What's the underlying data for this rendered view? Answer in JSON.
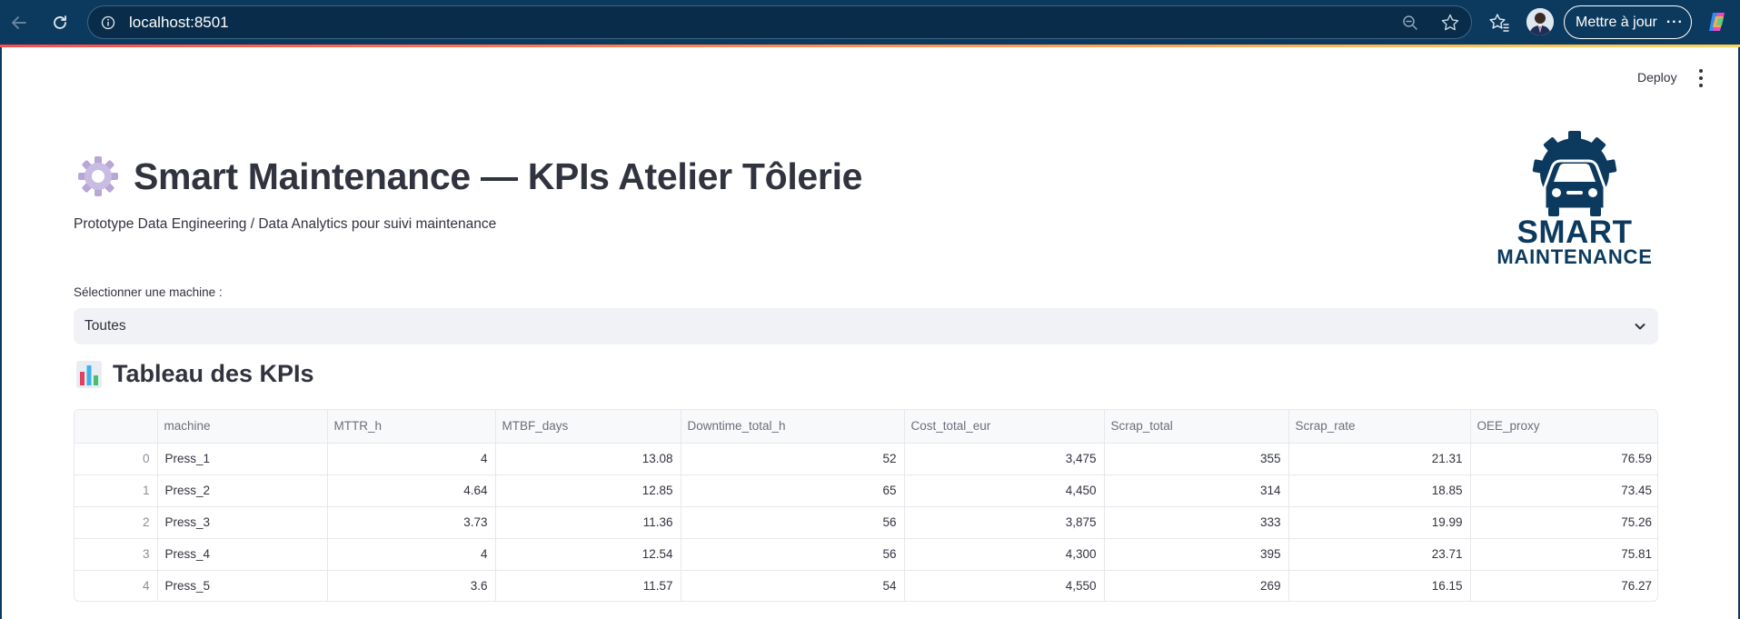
{
  "browser": {
    "url": "localhost:8501",
    "update_label": "Mettre à jour",
    "more_dots": "···"
  },
  "app": {
    "deploy_label": "Deploy",
    "title": "Smart Maintenance — KPIs Atelier Tôlerie",
    "subtitle": "Prototype Data Engineering / Data Analytics pour suivi maintenance",
    "logo_line1": "SMART",
    "logo_line2": "MAINTENANCE",
    "select": {
      "label": "Sélectionner une machine :",
      "value": "Toutes"
    },
    "section_title": "Tableau des KPIs"
  },
  "table": {
    "columns": [
      "",
      "machine",
      "MTTR_h",
      "MTBF_days",
      "Downtime_total_h",
      "Cost_total_eur",
      "Scrap_total",
      "Scrap_rate",
      "OEE_proxy"
    ],
    "rows": [
      [
        "0",
        "Press_1",
        "4",
        "13.08",
        "52",
        "3,475",
        "355",
        "21.31",
        "76.59"
      ],
      [
        "1",
        "Press_2",
        "4.64",
        "12.85",
        "65",
        "4,450",
        "314",
        "18.85",
        "73.45"
      ],
      [
        "2",
        "Press_3",
        "3.73",
        "11.36",
        "56",
        "3,875",
        "333",
        "19.99",
        "75.26"
      ],
      [
        "3",
        "Press_4",
        "4",
        "12.54",
        "56",
        "4,300",
        "395",
        "23.71",
        "75.81"
      ],
      [
        "4",
        "Press_5",
        "3.6",
        "11.57",
        "54",
        "4,550",
        "269",
        "16.15",
        "76.27"
      ]
    ]
  },
  "colors": {
    "chrome": "#0c3a5e",
    "accent_start": "#ff4b4b",
    "accent_end": "#ffd25a",
    "text": "#31333f",
    "select_bg": "#f0f2f6"
  }
}
